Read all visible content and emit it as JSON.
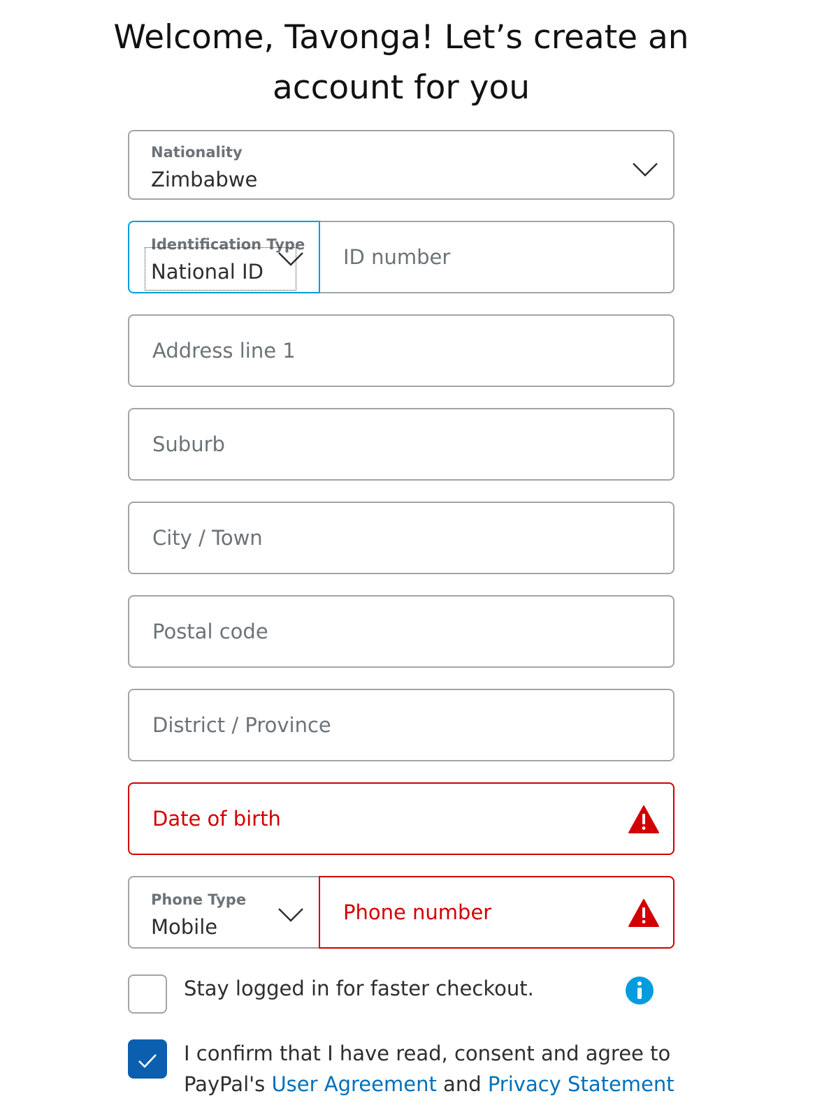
{
  "heading": {
    "line1": "Welcome, Tavonga! Let’s create an",
    "line2": "account for you"
  },
  "nationality": {
    "label": "Nationality",
    "value": "Zimbabwe"
  },
  "identification": {
    "type_label": "Identification Type",
    "type_value": "National ID",
    "number_placeholder": "ID number"
  },
  "address_line1": {
    "placeholder": "Address line 1"
  },
  "suburb": {
    "placeholder": "Suburb"
  },
  "city": {
    "placeholder": "City / Town"
  },
  "postal_code": {
    "placeholder": "Postal code"
  },
  "district": {
    "placeholder": "District / Province"
  },
  "date_of_birth": {
    "placeholder": "Date of birth",
    "state": "error"
  },
  "phone": {
    "type_label": "Phone Type",
    "type_value": "Mobile",
    "number_placeholder": "Phone number",
    "number_state": "error"
  },
  "stay_logged_in": {
    "label": "Stay logged in for faster checkout.",
    "checked": false
  },
  "consent": {
    "line1": "I confirm that I have read, consent and agree to",
    "line2_prefix": "PayPal's ",
    "user_agreement_link": "User Agreement",
    "line2_and": " and ",
    "privacy_link": "Privacy Statement",
    "checked": true
  },
  "colors": {
    "error": "#d20000",
    "focus": "#009cde",
    "link": "#0070ba",
    "checkbox_checked": "#0c5faf",
    "info": "#009cde"
  },
  "icons": [
    "chevron-down-icon",
    "warning-icon",
    "info-icon",
    "checkmark-icon"
  ]
}
